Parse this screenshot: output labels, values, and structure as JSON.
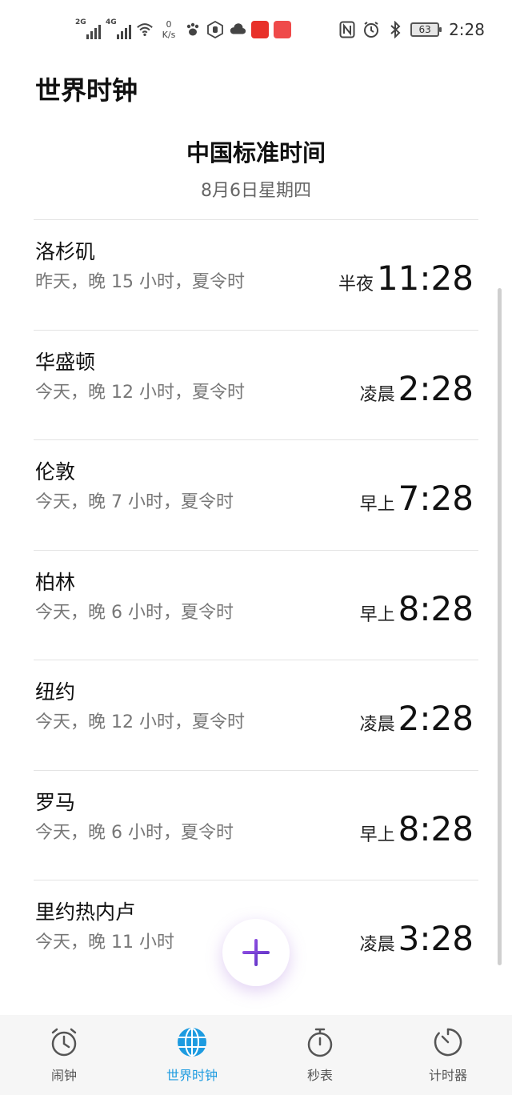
{
  "status_bar": {
    "sim1": "2G",
    "sim2": "4G",
    "net_speed_value": "0",
    "net_speed_unit": "K/s",
    "battery": "63",
    "time": "2:28"
  },
  "header": {
    "title": "世界时钟"
  },
  "home_zone": {
    "name": "中国标准时间",
    "date": "8月6日星期四"
  },
  "cities": [
    {
      "name": "洛杉矶",
      "desc": "昨天，晚 15 小时，夏令时",
      "period": "半夜",
      "time": "11:28"
    },
    {
      "name": "华盛顿",
      "desc": "今天，晚 12 小时，夏令时",
      "period": "凌晨",
      "time": "2:28"
    },
    {
      "name": "伦敦",
      "desc": "今天，晚 7 小时，夏令时",
      "period": "早上",
      "time": "7:28"
    },
    {
      "name": "柏林",
      "desc": "今天，晚 6 小时，夏令时",
      "period": "早上",
      "time": "8:28"
    },
    {
      "name": "纽约",
      "desc": "今天，晚 12 小时，夏令时",
      "period": "凌晨",
      "time": "2:28"
    },
    {
      "name": "罗马",
      "desc": "今天，晚 6 小时，夏令时",
      "period": "早上",
      "time": "8:28"
    },
    {
      "name": "里约热内卢",
      "desc": "今天，晚 11 小时",
      "period": "凌晨",
      "time": "3:28"
    }
  ],
  "fab": {
    "icon": "plus-icon"
  },
  "bottom_nav": [
    {
      "label": "闹钟",
      "icon": "alarm-clock-icon",
      "active": false
    },
    {
      "label": "世界时钟",
      "icon": "globe-icon",
      "active": true
    },
    {
      "label": "秒表",
      "icon": "stopwatch-icon",
      "active": false
    },
    {
      "label": "计时器",
      "icon": "timer-icon",
      "active": false
    }
  ],
  "colors": {
    "accent": "#1d9be0",
    "fab_plus": "#7b3fd6"
  }
}
